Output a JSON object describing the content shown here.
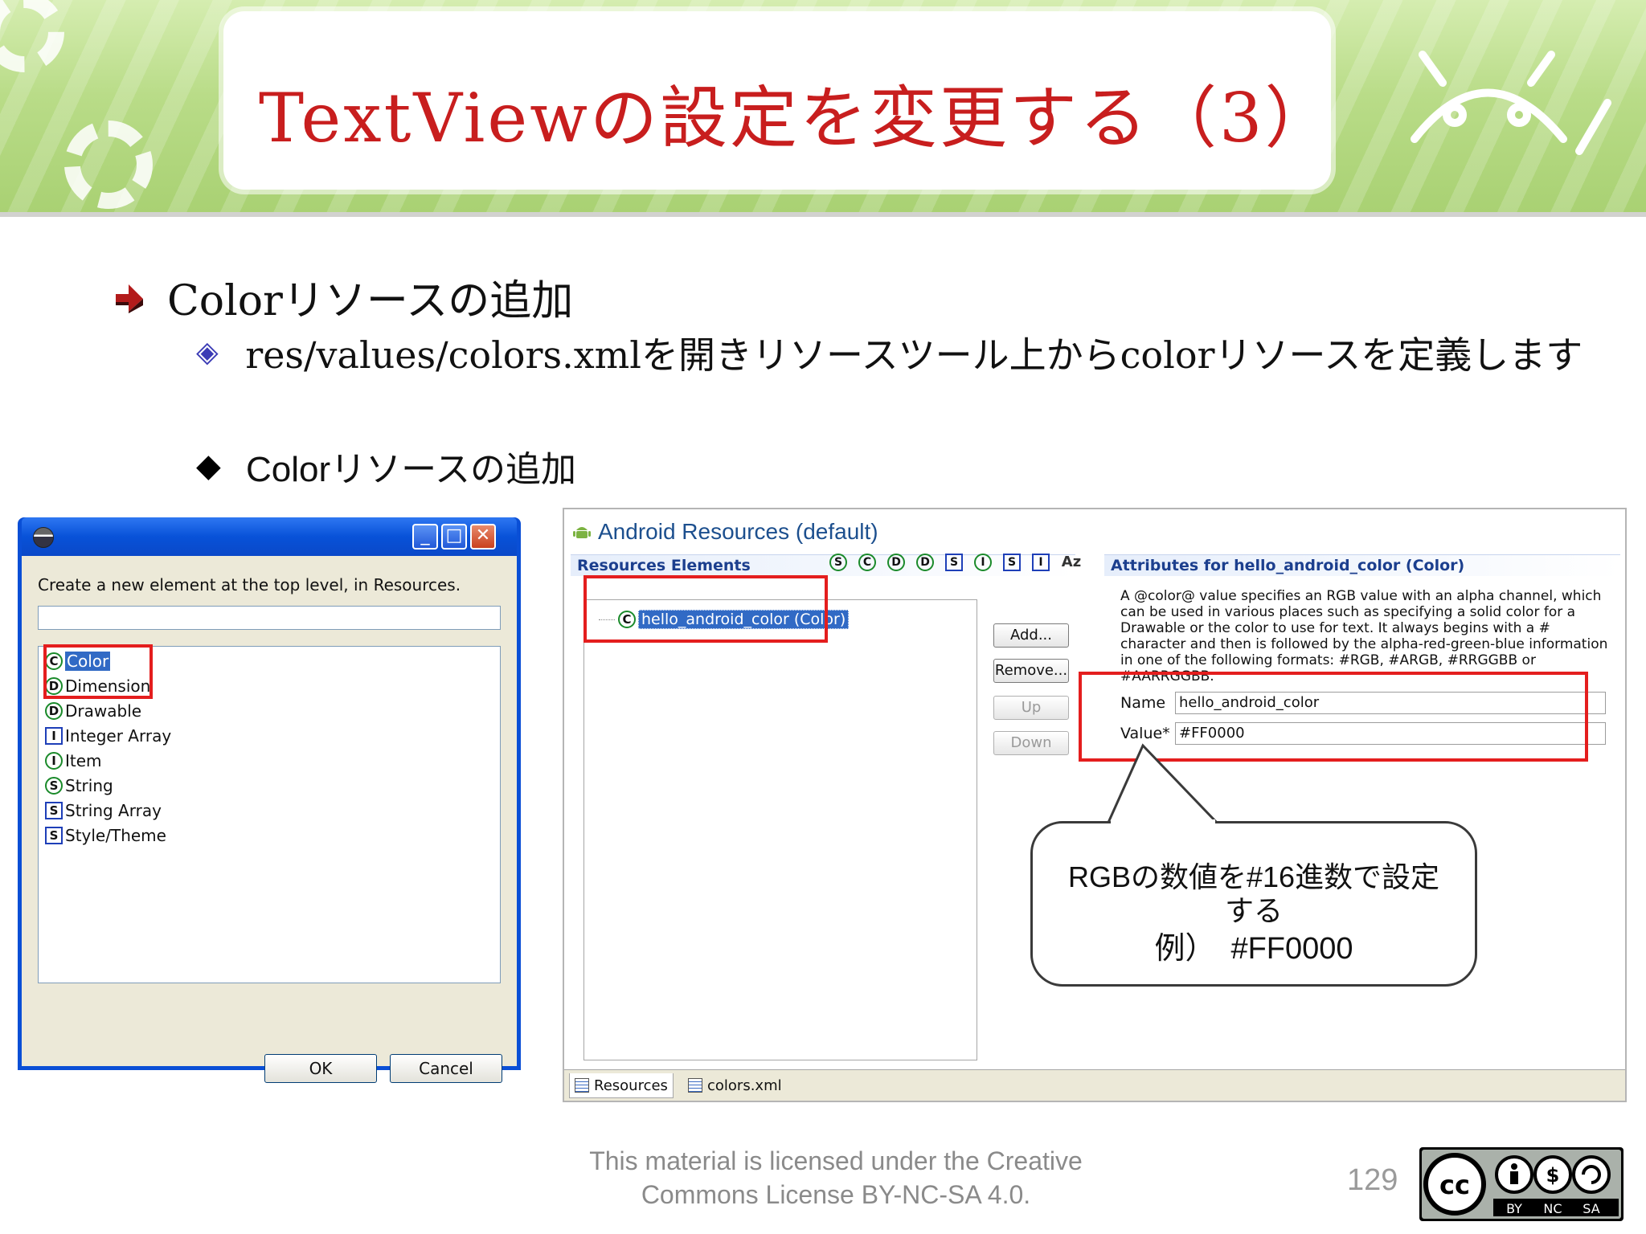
{
  "slide": {
    "title": "TextViewの設定を変更する（3）",
    "bullet1": "Colorリソースの追加",
    "bullet2": "res/values/colors.xmlを開きリソースツール上からcolorリソースを定義します",
    "bullet3": "Colorリソースの追加"
  },
  "dialog": {
    "prompt": "Create a new element at the top level, in Resources.",
    "filter_value": "",
    "items": [
      {
        "icon": "C",
        "shape": "circle",
        "label": "Color",
        "selected": true
      },
      {
        "icon": "D",
        "shape": "circle",
        "label": "Dimension",
        "selected": false
      },
      {
        "icon": "D",
        "shape": "circle",
        "label": "Drawable",
        "selected": false
      },
      {
        "icon": "I",
        "shape": "square",
        "label": "Integer Array",
        "selected": false
      },
      {
        "icon": "I",
        "shape": "circle",
        "label": "Item",
        "selected": false
      },
      {
        "icon": "S",
        "shape": "circle",
        "label": "String",
        "selected": false
      },
      {
        "icon": "S",
        "shape": "square",
        "label": "String Array",
        "selected": false
      },
      {
        "icon": "S",
        "shape": "square",
        "label": "Style/Theme",
        "selected": false
      }
    ],
    "ok_label": "OK",
    "cancel_label": "Cancel",
    "window_buttons": {
      "minimize": "_",
      "maximize": "□",
      "close": "✕"
    }
  },
  "editor": {
    "title": "Android Resources (default)",
    "elements_section": "Resources Elements",
    "toolbar_icons": [
      {
        "glyph": "S",
        "shape": "circle"
      },
      {
        "glyph": "C",
        "shape": "circle"
      },
      {
        "glyph": "D",
        "shape": "circle"
      },
      {
        "glyph": "D",
        "shape": "circle"
      },
      {
        "glyph": "S",
        "shape": "square"
      },
      {
        "glyph": "I",
        "shape": "circle"
      },
      {
        "glyph": "S",
        "shape": "square"
      },
      {
        "glyph": "I",
        "shape": "square"
      },
      {
        "glyph": "Az",
        "shape": "sort"
      }
    ],
    "tree_item": {
      "icon": "C",
      "label": "hello_android_color (Color)"
    },
    "buttons": {
      "add": "Add...",
      "remove": "Remove...",
      "up": "Up",
      "down": "Down"
    },
    "attributes_section": "Attributes for hello_android_color (Color)",
    "description": "A @color@ value specifies an RGB value with an alpha channel, which can be used in various places such as specifying a solid color for a Drawable or the color to use for text. It always begins with a # character and then is followed by the alpha-red-green-blue information in one of the following formats: #RGB, #ARGB, #RRGGBB or #AARRGGBB.",
    "name_label": "Name",
    "name_value": "hello_android_color",
    "value_label": "Value*",
    "value_value": "#FF0000",
    "tabs": [
      "Resources",
      "colors.xml"
    ]
  },
  "callout": {
    "line1": "RGBの数値を#16進数で設定",
    "line2": "する",
    "line3": "例）　#FF0000"
  },
  "footer": {
    "license_line1": "This material is licensed under the Creative",
    "license_line2": "Commons License BY-NC-SA 4.0.",
    "page_number": "129",
    "cc_badge": {
      "main": "cc",
      "terms": [
        "BY",
        "NC",
        "SA"
      ]
    }
  },
  "colors": {
    "title_red": "#c81e1e",
    "highlight_red": "#e41e1e",
    "banner_green": "#b9dc88",
    "xp_blue": "#0a4fd6",
    "selection_blue": "#316ac5"
  }
}
